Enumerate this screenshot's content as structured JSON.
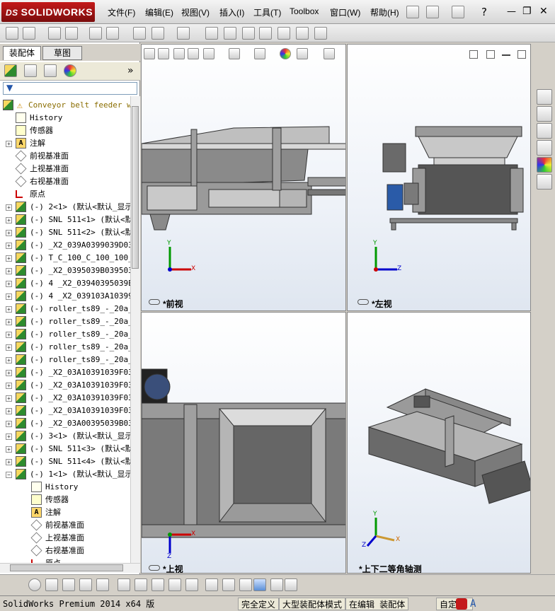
{
  "app": {
    "logo_ds": "DS",
    "logo_text": "SOLIDWORKS",
    "menus": [
      "文件(F)",
      "编辑(E)",
      "视图(V)",
      "插入(I)",
      "工具(T)",
      "Toolbox",
      "窗口(W)",
      "帮助(H)"
    ],
    "window_controls": {
      "minimize": "—",
      "restore": "❐",
      "close": "✕"
    },
    "help": "?"
  },
  "panel": {
    "tabs": [
      "装配体",
      "草图"
    ],
    "expand": "»",
    "tree": [
      {
        "level": 0,
        "toggle": "",
        "icon": "assembly",
        "label": "Conveyor belt feeder wit",
        "warn": true
      },
      {
        "level": 1,
        "toggle": "",
        "icon": "hist",
        "label": "History"
      },
      {
        "level": 1,
        "toggle": "",
        "icon": "sensor",
        "label": "传感器"
      },
      {
        "level": 1,
        "toggle": "+",
        "icon": "note",
        "label": "注解"
      },
      {
        "level": 1,
        "toggle": "",
        "icon": "plane",
        "label": "前视基准面"
      },
      {
        "level": 1,
        "toggle": "",
        "icon": "plane",
        "label": "上视基准面"
      },
      {
        "level": 1,
        "toggle": "",
        "icon": "plane",
        "label": "右视基准面"
      },
      {
        "level": 1,
        "toggle": "",
        "icon": "origin",
        "label": "原点"
      },
      {
        "level": 1,
        "toggle": "+",
        "icon": "part",
        "label": "(-) 2<1> (默认<默认_显示"
      },
      {
        "level": 1,
        "toggle": "+",
        "icon": "part",
        "label": "(-) SNL 511<1> (默认<默"
      },
      {
        "level": 1,
        "toggle": "+",
        "icon": "part",
        "label": "(-) SNL 511<2> (默认<默"
      },
      {
        "level": 1,
        "toggle": "+",
        "icon": "part",
        "label": "(-) _X2_039A0399039D039"
      },
      {
        "level": 1,
        "toggle": "+",
        "icon": "part",
        "label": "(-) T_C_100_C_100_100_B"
      },
      {
        "level": 1,
        "toggle": "+",
        "icon": "part",
        "label": "(-) _X2_0395039B039503A"
      },
      {
        "level": 1,
        "toggle": "+",
        "icon": "part",
        "label": "(-) 4 _X2_03940395039E0"
      },
      {
        "level": 1,
        "toggle": "+",
        "icon": "part",
        "label": "(-) 4 _X2_039103A103990"
      },
      {
        "level": 1,
        "toggle": "+",
        "icon": "part",
        "label": "(-) roller_ts89_-_20a_-"
      },
      {
        "level": 1,
        "toggle": "+",
        "icon": "part",
        "label": "(-) roller_ts89_-_20a_-"
      },
      {
        "level": 1,
        "toggle": "+",
        "icon": "part",
        "label": "(-) roller_ts89_-_20a_-"
      },
      {
        "level": 1,
        "toggle": "+",
        "icon": "part",
        "label": "(-) roller_ts89_-_20a_-"
      },
      {
        "level": 1,
        "toggle": "+",
        "icon": "part",
        "label": "(-) roller_ts89_-_20a_-"
      },
      {
        "level": 1,
        "toggle": "+",
        "icon": "part",
        "label": "(-) _X2_03A10391039F03A"
      },
      {
        "level": 1,
        "toggle": "+",
        "icon": "part",
        "label": "(-) _X2_03A10391039F03A"
      },
      {
        "level": 1,
        "toggle": "+",
        "icon": "part",
        "label": "(-) _X2_03A10391039F03A"
      },
      {
        "level": 1,
        "toggle": "+",
        "icon": "part",
        "label": "(-) _X2_03A10391039F03A"
      },
      {
        "level": 1,
        "toggle": "+",
        "icon": "part",
        "label": "(-) _X2_03A00395039B039"
      },
      {
        "level": 1,
        "toggle": "+",
        "icon": "part",
        "label": "(-) 3<1> (默认<默认_显示"
      },
      {
        "level": 1,
        "toggle": "+",
        "icon": "part",
        "label": "(-) SNL 511<3> (默认<默"
      },
      {
        "level": 1,
        "toggle": "+",
        "icon": "part",
        "label": "(-) SNL 511<4> (默认<默"
      },
      {
        "level": 1,
        "toggle": "−",
        "icon": "part",
        "label": "(-) 1<1> (默认<默认_显示"
      },
      {
        "level": 2,
        "toggle": "",
        "icon": "hist",
        "label": "History"
      },
      {
        "level": 2,
        "toggle": "",
        "icon": "sensor",
        "label": "传感器"
      },
      {
        "level": 2,
        "toggle": "",
        "icon": "note",
        "label": "注解"
      },
      {
        "level": 2,
        "toggle": "",
        "icon": "plane",
        "label": "前视基准面"
      },
      {
        "level": 2,
        "toggle": "",
        "icon": "plane",
        "label": "上视基准面"
      },
      {
        "level": 2,
        "toggle": "",
        "icon": "plane",
        "label": "右视基准面"
      },
      {
        "level": 2,
        "toggle": "",
        "icon": "origin",
        "label": "原点"
      }
    ]
  },
  "viewports": {
    "front": {
      "label": "*前视",
      "axis_x": "X",
      "axis_y": "Y"
    },
    "left": {
      "label": "*左视",
      "axis_y": "Y",
      "axis_z": "Z"
    },
    "top": {
      "label": "*上视",
      "axis_x": "X",
      "axis_z": "Z"
    },
    "iso": {
      "label": "*上下二等角轴测",
      "axis_x": "X",
      "axis_y": "Y",
      "axis_z": "Z"
    }
  },
  "status": {
    "version": "SolidWorks Premium 2014 x64 版",
    "fully_defined": "完全定义",
    "large_assembly": "大型装配体模式",
    "editing": "在编辑 装配体",
    "custom": "自定"
  },
  "colors": {
    "accent": "#c41a1a",
    "axis_x": "#cc0000",
    "axis_y": "#009900",
    "axis_z": "#0000cc"
  }
}
